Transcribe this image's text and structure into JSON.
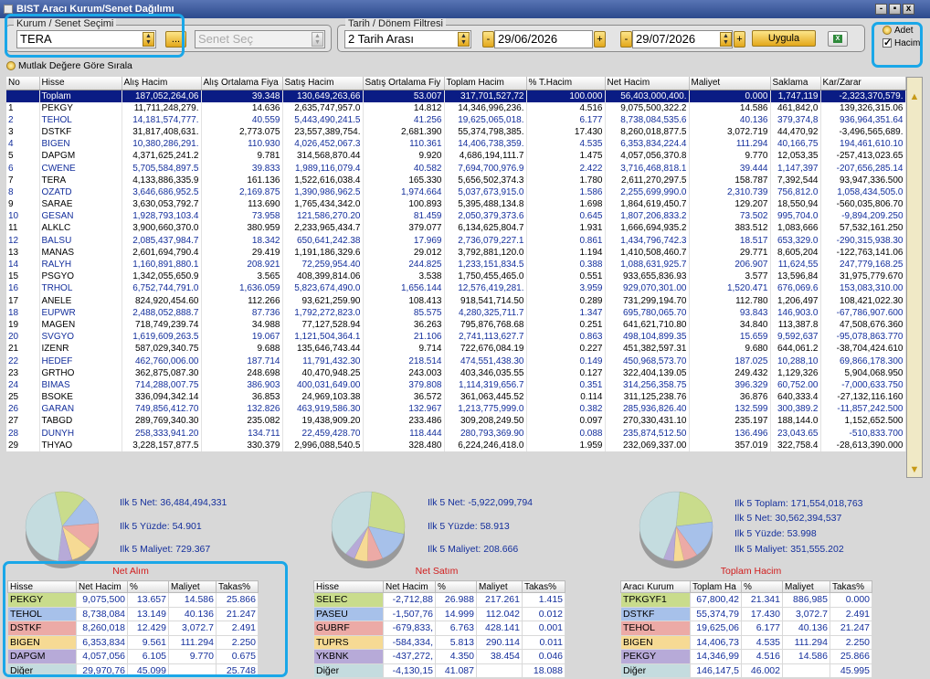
{
  "window": {
    "title": "BIST Aracı Kurum/Senet Dağılımı",
    "buttons": [
      "-",
      "▪",
      "x"
    ]
  },
  "filters": {
    "kurum_group_title": "Kurum / Senet Seçimi",
    "kurum_value": "TERA",
    "dots_label": "...",
    "senet_placeholder": "Senet Seç",
    "date_group_title": "Tarih / Dönem Filtresi",
    "period_value": "2 Tarih Arası",
    "date_start": "29/06/2026",
    "date_end": "29/07/2026",
    "apply_label": "Uygula",
    "adet_label": "Adet",
    "hacim_label": "Hacim",
    "sort_label": "Mutlak Değere Göre Sırala"
  },
  "table": {
    "columns": [
      "No",
      "Hisse",
      "Alış Hacim",
      "Alış Ortalama Fiya",
      "Satış Hacim",
      "Satış Ortalama Fiy",
      "Toplam Hacim",
      "% T.Hacim",
      "Net Hacim",
      "Maliyet",
      "Saklama",
      "Kar/Zarar"
    ],
    "rows": [
      [
        "",
        "Toplam",
        "187,052,264,06",
        "39.348",
        "130,649,263,66",
        "53.007",
        "317,701,527,72",
        "100.000",
        "56,403,000,400.",
        "0.000",
        "1,747,119",
        "-2,323,370,579."
      ],
      [
        "1",
        "PEKGY",
        "11,711,248,279.",
        "14.636",
        "2,635,747,957.0",
        "14.812",
        "14,346,996,236.",
        "4.516",
        "9,075,500,322.2",
        "14.586",
        "461,842,0",
        "139,326,315.06"
      ],
      [
        "2",
        "TEHOL",
        "14,181,574,777.",
        "40.559",
        "5,443,490,241.5",
        "41.256",
        "19,625,065,018.",
        "6.177",
        "8,738,084,535.6",
        "40.136",
        "379,374,8",
        "936,964,351.64"
      ],
      [
        "3",
        "DSTKF",
        "31,817,408,631.",
        "2,773.075",
        "23,557,389,754.",
        "2,681.390",
        "55,374,798,385.",
        "17.430",
        "8,260,018,877.5",
        "3,072.719",
        "44,470,92",
        "-3,496,565,689."
      ],
      [
        "4",
        "BIGEN",
        "10,380,286,291.",
        "110.930",
        "4,026,452,067.3",
        "110.361",
        "14,406,738,359.",
        "4.535",
        "6,353,834,224.4",
        "111.294",
        "40,166,75",
        "194,461,610.10"
      ],
      [
        "5",
        "DAPGM",
        "4,371,625,241.2",
        "9.781",
        "314,568,870.44",
        "9.920",
        "4,686,194,111.7",
        "1.475",
        "4,057,056,370.8",
        "9.770",
        "12,053,35",
        "-257,413,023.65"
      ],
      [
        "6",
        "CWENE",
        "5,705,584,897.5",
        "39.833",
        "1,989,116,079.4",
        "40.582",
        "7,694,700,976.9",
        "2.422",
        "3,716,468,818.1",
        "39.444",
        "1,147,397",
        "-207,656,285.14"
      ],
      [
        "7",
        "TERA",
        "4,133,886,335.9",
        "161.136",
        "1,522,616,038.4",
        "165.330",
        "5,656,502,374.3",
        "1.780",
        "2,611,270,297.5",
        "158.787",
        "7,392,544",
        "93,947,336.500"
      ],
      [
        "8",
        "OZATD",
        "3,646,686,952.5",
        "2,169.875",
        "1,390,986,962.5",
        "1,974.664",
        "5,037,673,915.0",
        "1.586",
        "2,255,699,990.0",
        "2,310.739",
        "756,812.0",
        "1,058,434,505.0"
      ],
      [
        "9",
        "SARAE",
        "3,630,053,792.7",
        "113.690",
        "1,765,434,342.0",
        "100.893",
        "5,395,488,134.8",
        "1.698",
        "1,864,619,450.7",
        "129.207",
        "18,550,94",
        "-560,035,806.70"
      ],
      [
        "10",
        "GESAN",
        "1,928,793,103.4",
        "73.958",
        "121,586,270.20",
        "81.459",
        "2,050,379,373.6",
        "0.645",
        "1,807,206,833.2",
        "73.502",
        "995,704.0",
        "-9,894,209.250"
      ],
      [
        "11",
        "ALKLC",
        "3,900,660,370.0",
        "380.959",
        "2,233,965,434.7",
        "379.077",
        "6,134,625,804.7",
        "1.931",
        "1,666,694,935.2",
        "383.512",
        "1,083,666",
        "57,532,161.250"
      ],
      [
        "12",
        "BALSU",
        "2,085,437,984.7",
        "18.342",
        "650,641,242.38",
        "17.969",
        "2,736,079,227.1",
        "0.861",
        "1,434,796,742.3",
        "18.517",
        "653,329.0",
        "-290,315,938.30"
      ],
      [
        "13",
        "MANAS",
        "2,601,694,790.4",
        "29.419",
        "1,191,186,329.6",
        "29.012",
        "3,792,881,120.0",
        "1.194",
        "1,410,508,460.7",
        "29.771",
        "8,605,204",
        "-122,763,141.06"
      ],
      [
        "14",
        "RALYH",
        "1,160,891,880.1",
        "208.921",
        "72,259,954.40",
        "244.825",
        "1,233,151,834.5",
        "0.388",
        "1,088,631,925.7",
        "206.907",
        "11,624,55",
        "247,779,168.25"
      ],
      [
        "15",
        "PSGYO",
        "1,342,055,650.9",
        "3.565",
        "408,399,814.06",
        "3.538",
        "1,750,455,465.0",
        "0.551",
        "933,655,836.93",
        "3.577",
        "13,596,84",
        "31,975,779.670"
      ],
      [
        "16",
        "TRHOL",
        "6,752,744,791.0",
        "1,636.059",
        "5,823,674,490.0",
        "1,656.144",
        "12,576,419,281.",
        "3.959",
        "929,070,301.00",
        "1,520.471",
        "676,069.6",
        "153,083,310.00"
      ],
      [
        "17",
        "ANELE",
        "824,920,454.60",
        "112.266",
        "93,621,259.90",
        "108.413",
        "918,541,714.50",
        "0.289",
        "731,299,194.70",
        "112.780",
        "1,206,497",
        "108,421,022.30"
      ],
      [
        "18",
        "EUPWR",
        "2,488,052,888.7",
        "87.736",
        "1,792,272,823.0",
        "85.575",
        "4,280,325,711.7",
        "1.347",
        "695,780,065.70",
        "93.843",
        "146,903.0",
        "-67,786,907.600"
      ],
      [
        "19",
        "MAGEN",
        "718,749,239.74",
        "34.988",
        "77,127,528.94",
        "36.263",
        "795,876,768.68",
        "0.251",
        "641,621,710.80",
        "34.840",
        "113,387.8",
        "47,508,676.360"
      ],
      [
        "20",
        "SVGYO",
        "1,619,609,263.5",
        "19.067",
        "1,121,504,364.1",
        "21.106",
        "2,741,113,627.7",
        "0.863",
        "498,104,899.35",
        "15.659",
        "9,592,637",
        "-95,078,863.770"
      ],
      [
        "21",
        "IZENR",
        "587,029,340.75",
        "9.688",
        "135,646,743.44",
        "9.714",
        "722,676,084.19",
        "0.227",
        "451,382,597.31",
        "9.680",
        "644,061.2",
        "-38,704,424.610"
      ],
      [
        "22",
        "HEDEF",
        "462,760,006.00",
        "187.714",
        "11,791,432.30",
        "218.514",
        "474,551,438.30",
        "0.149",
        "450,968,573.70",
        "187.025",
        "10,288,10",
        "69,866,178.300"
      ],
      [
        "23",
        "GRTHO",
        "362,875,087.30",
        "248.698",
        "40,470,948.25",
        "243.003",
        "403,346,035.55",
        "0.127",
        "322,404,139.05",
        "249.432",
        "1,129,326",
        "5,904,068.950"
      ],
      [
        "24",
        "BIMAS",
        "714,288,007.75",
        "386.903",
        "400,031,649.00",
        "379.808",
        "1,114,319,656.7",
        "0.351",
        "314,256,358.75",
        "396.329",
        "60,752.00",
        "-7,000,633.750"
      ],
      [
        "25",
        "BSOKE",
        "336,094,342.14",
        "36.853",
        "24,969,103.38",
        "36.572",
        "361,063,445.52",
        "0.114",
        "311,125,238.76",
        "36.876",
        "640,333.4",
        "-27,132,116.160"
      ],
      [
        "26",
        "GARAN",
        "749,856,412.70",
        "132.826",
        "463,919,586.30",
        "132.967",
        "1,213,775,999.0",
        "0.382",
        "285,936,826.40",
        "132.599",
        "300,389.2",
        "-11,857,242.500"
      ],
      [
        "27",
        "TABGD",
        "289,769,340.30",
        "235.082",
        "19,438,909.20",
        "233.486",
        "309,208,249.50",
        "0.097",
        "270,330,431.10",
        "235.197",
        "188,144.0",
        "1,152,652.500"
      ],
      [
        "28",
        "DUNYH",
        "258,333,941.20",
        "134.711",
        "22,459,428.70",
        "118.444",
        "280,793,369.90",
        "0.088",
        "235,874,512.50",
        "136.496",
        "23,043.65",
        "-510,833.700"
      ],
      [
        "29",
        "THYAO",
        "3,228,157,877.5",
        "330.379",
        "2,996,088,540.5",
        "328.480",
        "6,224,246,418.0",
        "1.959",
        "232,069,337.00",
        "357.019",
        "322,758.4",
        "-28,613,390.000"
      ]
    ]
  },
  "colors": {
    "pekgy": "#c9dc8c",
    "tehol": "#a7c1ea",
    "dstkf": "#ecaaa6",
    "bigen": "#f6da94",
    "dapgm": "#b7aad8",
    "diger": "#c4dcdf"
  },
  "panels": [
    {
      "title": "Net Alım",
      "stats": [
        "Ilk 5 Net: 36,484,494,331",
        "Ilk 5 Yüzde: 54.901",
        "Ilk 5 Maliyet: 729.367"
      ],
      "pie": [
        13.657,
        13.149,
        12.429,
        9.561,
        6.105,
        45.099
      ],
      "headers": [
        "Hisse",
        "Net Hacim",
        "%",
        "Maliyet",
        "Takas%"
      ],
      "rows": [
        [
          "PEKGY",
          "9,075,500",
          "13.657",
          "14.586",
          "25.866"
        ],
        [
          "TEHOL",
          "8,738,084",
          "13.149",
          "40.136",
          "21.247"
        ],
        [
          "DSTKF",
          "8,260,018",
          "12.429",
          "3,072.7",
          "2.491"
        ],
        [
          "BIGEN",
          "6,353,834",
          "9.561",
          "111.294",
          "2.250"
        ],
        [
          "DAPGM",
          "4,057,056",
          "6.105",
          "9.770",
          "0.675"
        ],
        [
          "Diğer",
          "29,970,76",
          "45.099",
          "",
          "25.748"
        ]
      ]
    },
    {
      "title": "Net Satım",
      "stats": [
        "Ilk 5 Net: -5,922,099,794",
        "Ilk 5 Yüzde: 58.913",
        "Ilk 5 Maliyet: 208.666"
      ],
      "pie": [
        26.988,
        14.999,
        6.763,
        5.813,
        4.35,
        41.087
      ],
      "headers": [
        "Hisse",
        "Net Hacim",
        "%",
        "Maliyet",
        "Takas%"
      ],
      "rows": [
        [
          "SELEC",
          "-2,712,88",
          "26.988",
          "217.261",
          "1.415"
        ],
        [
          "PASEU",
          "-1,507,76",
          "14.999",
          "112.042",
          "0.012"
        ],
        [
          "GUBRF",
          "-679,833,",
          "6.763",
          "428.141",
          "0.001"
        ],
        [
          "TUPRS",
          "-584,334,",
          "5.813",
          "290.114",
          "0.011"
        ],
        [
          "YKBNK",
          "-437,272,",
          "4.350",
          "38.454",
          "0.046"
        ],
        [
          "Diğer",
          "-4,130,15",
          "41.087",
          "",
          "18.088"
        ]
      ]
    },
    {
      "title": "Toplam Hacim",
      "stats": [
        "Ilk 5 Toplam: 171,554,018,763",
        "Ilk 5 Net: 30,562,394,537",
        "Ilk 5 Yüzde: 53.998",
        "Ilk 5 Maliyet: 351,555.202"
      ],
      "pie": [
        21.341,
        17.43,
        6.177,
        4.535,
        4.516,
        46.002
      ],
      "headers": [
        "Aracı Kurum",
        "Toplam Ha",
        "%",
        "Maliyet",
        "Takas%"
      ],
      "rows": [
        [
          "TPKGYF1",
          "67,800,42",
          "21.341",
          "886,985",
          "0.000"
        ],
        [
          "DSTKF",
          "55,374,79",
          "17.430",
          "3,072.7",
          "2.491"
        ],
        [
          "TEHOL",
          "19,625,06",
          "6.177",
          "40.136",
          "21.247"
        ],
        [
          "BIGEN",
          "14,406,73",
          "4.535",
          "111.294",
          "2.250"
        ],
        [
          "PEKGY",
          "14,346,99",
          "4.516",
          "14.586",
          "25.866"
        ],
        [
          "Diğer",
          "146,147,5",
          "46.002",
          "",
          "45.995"
        ]
      ]
    }
  ]
}
